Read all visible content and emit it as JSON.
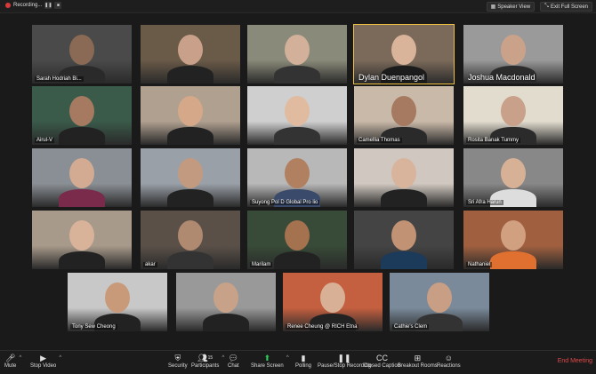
{
  "topbar": {
    "recording": "Recording...",
    "speaker_view": "Speaker View",
    "exit_full": "Exit Full Screen"
  },
  "tiles": [
    {
      "name": "Sarah Hodriah Bi...",
      "style": "small"
    },
    {
      "name": "",
      "style": "small"
    },
    {
      "name": "",
      "style": "small"
    },
    {
      "name": "Dylan Duenpangol",
      "style": "big"
    },
    {
      "name": "Joshua Macdonald",
      "style": "big"
    },
    {
      "name": "Airul-V",
      "style": "small"
    },
    {
      "name": "",
      "style": "small"
    },
    {
      "name": "",
      "style": "small"
    },
    {
      "name": "Camellia Thomas",
      "style": "small"
    },
    {
      "name": "Rosita Banak Tummy",
      "style": "small"
    },
    {
      "name": "",
      "style": "small"
    },
    {
      "name": "",
      "style": "small"
    },
    {
      "name": "Suyong Pol D Global Pro lio",
      "style": "small"
    },
    {
      "name": "",
      "style": "small"
    },
    {
      "name": "Sri Afra Harun",
      "style": "small"
    },
    {
      "name": "",
      "style": "small"
    },
    {
      "name": "akar",
      "style": "small"
    },
    {
      "name": "Marilam",
      "style": "small"
    },
    {
      "name": "",
      "style": "small"
    },
    {
      "name": "Nathaniel",
      "style": "small"
    },
    {
      "name": "Tony Sew Cheong",
      "style": "small"
    },
    {
      "name": "",
      "style": "small"
    },
    {
      "name": "Renee Cheung @ RICH Etna",
      "style": "small"
    },
    {
      "name": "Cathie's Clem",
      "style": "small"
    }
  ],
  "toolbar": {
    "mute": "Mute",
    "stop_video": "Stop Video",
    "security": "Security",
    "participants": "Participants",
    "participants_count": "15",
    "chat": "Chat",
    "share_screen": "Share Screen",
    "polling": "Polling",
    "pause_recording": "Pause/Stop Recording",
    "closed_caption": "Closed Caption",
    "breakout_rooms": "Breakout Rooms",
    "reactions": "Reactions",
    "end_meeting": "End Meeting"
  },
  "colors": {
    "accent_green": "#2fcf59",
    "end_red": "#e04848",
    "rec_red": "#d63a3a",
    "active_outline": "#f0c040"
  }
}
